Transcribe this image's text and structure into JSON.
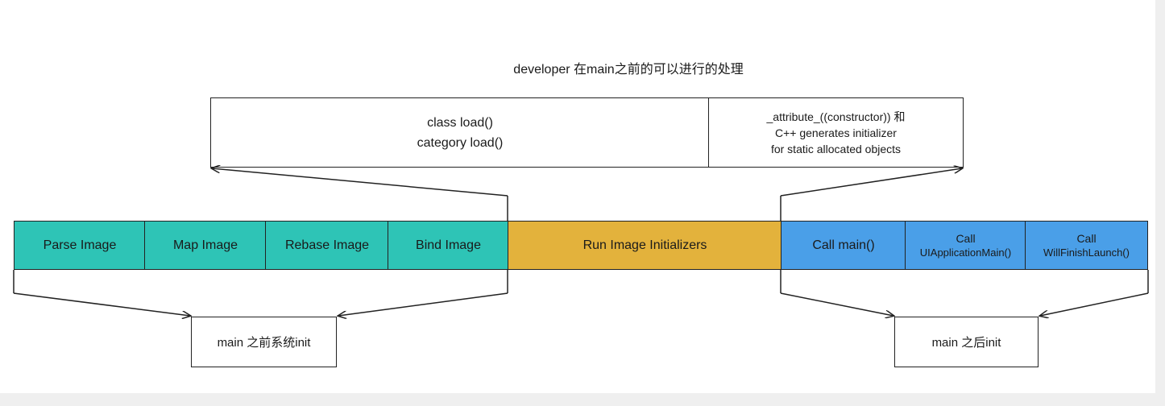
{
  "title": "developer 在main之前的可以进行的处理",
  "top_boxes": {
    "left": {
      "lines": [
        "class load()",
        "category load()"
      ]
    },
    "right": {
      "lines": [
        "_attribute_((constructor)) 和",
        "C++ generates initializer",
        "for static allocated objects"
      ]
    }
  },
  "phases": [
    {
      "id": "parse-image",
      "lines": [
        "Parse Image"
      ],
      "color": "#2ec4b6"
    },
    {
      "id": "map-image",
      "lines": [
        "Map Image"
      ],
      "color": "#2ec4b6"
    },
    {
      "id": "rebase-image",
      "lines": [
        "Rebase Image"
      ],
      "color": "#2ec4b6"
    },
    {
      "id": "bind-image",
      "lines": [
        "Bind Image"
      ],
      "color": "#2ec4b6"
    },
    {
      "id": "run-image-initializers",
      "lines": [
        "Run Image Initializers"
      ],
      "color": "#e3b23c"
    },
    {
      "id": "call-main",
      "lines": [
        "Call main()"
      ],
      "color": "#4a9fe8"
    },
    {
      "id": "call-uiapplicationmain",
      "lines": [
        "Call",
        "UIApplicationMain()"
      ],
      "color": "#4a9fe8"
    },
    {
      "id": "call-willfinishlaunch",
      "lines": [
        "Call",
        "WillFinishLaunch()"
      ],
      "color": "#4a9fe8"
    }
  ],
  "bottom_boxes": {
    "left": {
      "label": "main 之前系统init"
    },
    "right": {
      "label": "main 之后init"
    }
  },
  "colors": {
    "system_phase": "#2ec4b6",
    "initializer_phase": "#e3b23c",
    "after_main_phase": "#4a9fe8",
    "stroke": "#222222"
  }
}
